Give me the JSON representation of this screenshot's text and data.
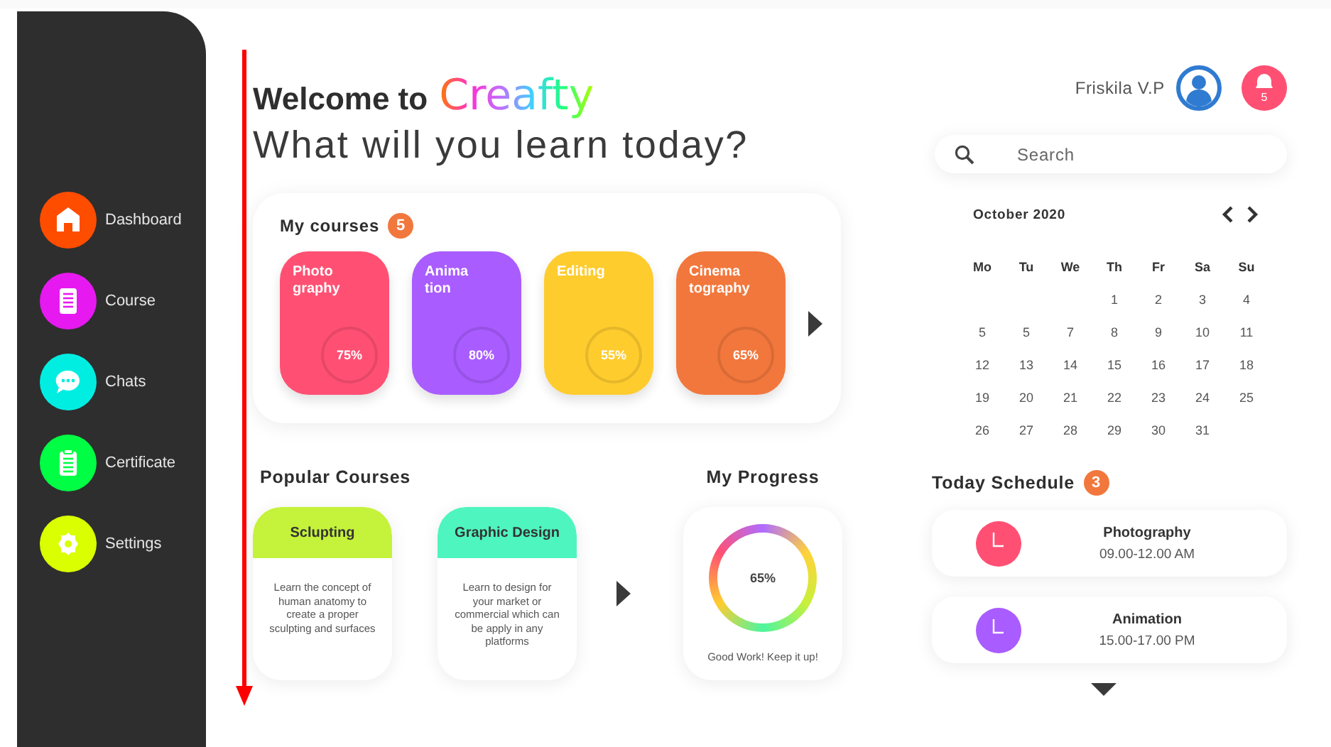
{
  "sidebar": {
    "items": [
      {
        "label": "Dashboard",
        "color": "#ff4d00"
      },
      {
        "label": "Course",
        "color": "#e619f0"
      },
      {
        "label": "Chats",
        "color": "#00eee2"
      },
      {
        "label": "Certificate",
        "color": "#00ff44"
      },
      {
        "label": "Settings",
        "color": "#d9ff00"
      }
    ]
  },
  "header": {
    "welcome": "Welcome to",
    "brand": "Creafty",
    "subtitle": "What will you learn today?",
    "user_name": "Friskila V.P",
    "notification_count": "5"
  },
  "search": {
    "placeholder": "Search"
  },
  "my_courses": {
    "title": "My courses",
    "count": "5",
    "courses": [
      {
        "title": "Photo\ngraphy",
        "progress": "75%",
        "color": "#ff5073"
      },
      {
        "title": "Anima\ntion",
        "progress": "80%",
        "color": "#a95cff"
      },
      {
        "title": "Editing",
        "progress": "55%",
        "color": "#ffcc2e"
      },
      {
        "title": "Cinema\ntography",
        "progress": "65%",
        "color": "#f2773c"
      }
    ]
  },
  "popular_courses": {
    "title": "Popular Courses",
    "courses": [
      {
        "title": "Sclupting",
        "description": "Learn the concept of human anatomy to create a proper sculpting and surfaces",
        "color": "#c5f23a"
      },
      {
        "title": "Graphic Design",
        "description": "Learn to design for your market or commercial which can be apply in any platforms",
        "color": "#4ff5be"
      }
    ]
  },
  "my_progress": {
    "title": "My Progress",
    "value": "65%",
    "message": "Good Work! Keep it up!"
  },
  "calendar": {
    "month": "October 2020",
    "weekdays": [
      "Mo",
      "Tu",
      "We",
      "Th",
      "Fr",
      "Sa",
      "Su"
    ],
    "weeks": [
      [
        "1",
        "2",
        "3",
        "4"
      ],
      [
        "5",
        "5",
        "7",
        "8",
        "9",
        "10",
        "11"
      ],
      [
        "12",
        "13",
        "14",
        "15",
        "16",
        "17",
        "18"
      ],
      [
        "19",
        "20",
        "21",
        "22",
        "23",
        "24",
        "25"
      ],
      [
        "26",
        "27",
        "28",
        "29",
        "30",
        "31"
      ]
    ]
  },
  "schedule": {
    "title": "Today Schedule",
    "count": "3",
    "items": [
      {
        "title": "Photography",
        "time": "09.00-12.00 AM",
        "color": "#ff5073"
      },
      {
        "title": "Animation",
        "time": "15.00-17.00 PM",
        "color": "#a95cff"
      }
    ]
  }
}
